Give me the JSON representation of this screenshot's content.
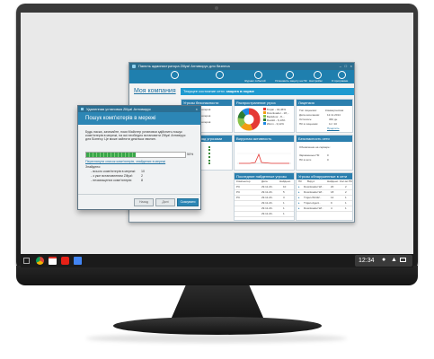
{
  "taskbar": {
    "clock": "12:34",
    "icons": [
      "chrome-icon",
      "gmail-icon",
      "youtube-icon",
      "files-icon"
    ]
  },
  "panel": {
    "title": "Панель администратора Zillya! Антивирус для бизнеса",
    "toolbar": [
      {
        "label": "Журнал событий",
        "icon": "journal-icon"
      },
      {
        "label": "Установить защиту на ПК",
        "icon": "install-icon"
      },
      {
        "label": "Настройки",
        "icon": "settings-icon"
      },
      {
        "label": "О программе",
        "icon": "info-icon"
      }
    ],
    "company_link": "Моя компания",
    "status_label": "Текущее состояние сети:",
    "status_value": "защита в норме",
    "sections": {
      "security": "Угрозы безопасности",
      "threats": "Распространение угроз",
      "license": "Лицензия",
      "control": "Контроль над угрозами",
      "activity": "Вирусная активность",
      "netsec": "Безопасность сети",
      "last_found": "Последние найденные угрозы",
      "detected": "Угрозы обнаруженные в сети"
    },
    "security_items": [
      "Нет компьютеров",
      "Нет компьютеров",
      "Нет компьютеров"
    ],
    "threat_legend": [
      {
        "name": "Trojan - 44,46%",
        "color": "#e53935"
      },
      {
        "name": "Downloader - 18,...",
        "color": "#f39c12"
      },
      {
        "name": "Backdoor - 8,...",
        "color": "#8bc34a"
      },
      {
        "name": "Rootkit - 6,13%",
        "color": "#2e7d32"
      },
      {
        "name": "Worm - 3,12%",
        "color": "#1e88e5"
      }
    ],
    "license_rows": [
      {
        "k": "Тип лицензии:",
        "v": "Коммерческая"
      },
      {
        "k": "Дата окончания:",
        "v": "12.11.2014"
      },
      {
        "k": "Осталось:",
        "v": "360 дн"
      },
      {
        "k": "ПК в лицензии:",
        "v": "11 / 10"
      }
    ],
    "license_link": "Продлить",
    "netsec_rows": [
      {
        "k": "Обновление на сервере:",
        "v": ""
      },
      {
        "k": "Зараженные ПК",
        "v": "0"
      },
      {
        "k": "ПК в сети",
        "v": "0"
      }
    ],
    "last_headers": [
      "Компьютер",
      "Дата",
      "Найдено"
    ],
    "last_rows": [
      {
        "pc": "PC",
        "date": "29.11.20..",
        "n": "10"
      },
      {
        "pc": "PC",
        "date": "29.11.20..",
        "n": "5"
      },
      {
        "pc": "PC",
        "date": "29.11.20..",
        "n": "3"
      },
      {
        "pc": "",
        "date": "29.11.20..",
        "n": "1"
      },
      {
        "pc": "",
        "date": "29.11.20..",
        "n": "1"
      },
      {
        "pc": "",
        "date": "29.11.20..",
        "n": "1"
      }
    ],
    "detected_headers": [
      "ПК",
      "Вирус",
      "Найдено",
      "Кол-во ПК"
    ],
    "detected_rows": [
      {
        "v": "Downloader.Wi..",
        "n": "20",
        "c": "2"
      },
      {
        "v": "Downloader.Wi..",
        "n": "18",
        "c": "2"
      },
      {
        "v": "Trojan.Win32..",
        "n": "12",
        "c": "1"
      },
      {
        "v": "Trojan.Agent..",
        "n": "9",
        "c": "1"
      },
      {
        "v": "Downloader.Wi..",
        "n": "4",
        "c": "1"
      }
    ]
  },
  "dialog": {
    "title": "Удаленная установка Zillya! Антивирус",
    "heading": "Пошук комп'ютерів в мережі",
    "text_lines": [
      "Будь ласка, зачекайте, поки Майстер установки здійснить пошук",
      "комп'ютерів в мережі, на які необхідно встановити Zillya! Антивірус",
      "для Бізнесу. Це може зайняти декілька хвилин."
    ],
    "progress_percent": 50,
    "progress_label": "50%",
    "details_link": "Переглянути список комп'ютерів, знайдених в мережі",
    "found_label": "Знайдено:",
    "found_rows": [
      {
        "k": "- всього комп'ютерів в мережі:",
        "v": "10"
      },
      {
        "k": "- з уже встановленим Zillya!:",
        "v": "2"
      },
      {
        "k": "- незахищених комп'ютерів:",
        "v": "8"
      }
    ],
    "back_label": "Назад",
    "next_label": "Далі",
    "cancel_label": "Скасувати"
  }
}
